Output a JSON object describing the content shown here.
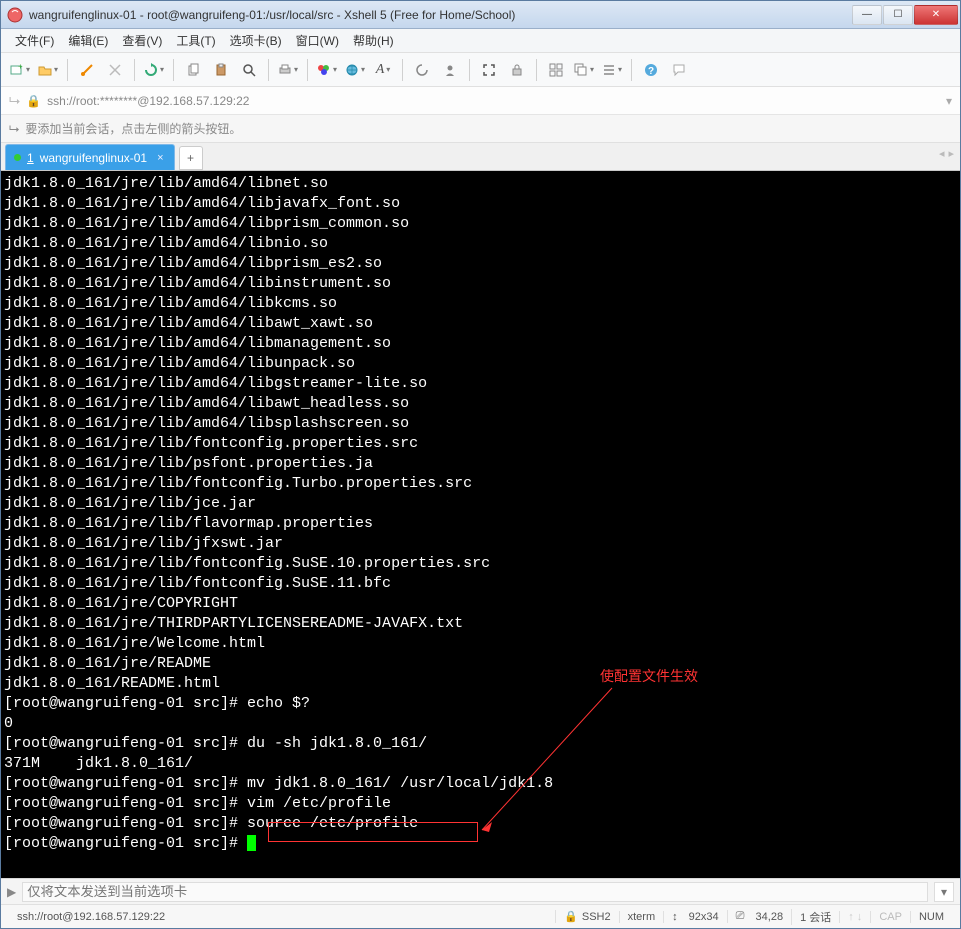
{
  "window": {
    "title": "wangruifenglinux-01 - root@wangruifeng-01:/usr/local/src - Xshell 5 (Free for Home/School)"
  },
  "menu": {
    "file": "文件(F)",
    "edit": "编辑(E)",
    "view": "查看(V)",
    "tools": "工具(T)",
    "tabs": "选项卡(B)",
    "window": "窗口(W)",
    "help": "帮助(H)"
  },
  "addressbar": {
    "lock_icon": "🔒",
    "url": "ssh://root:********@192.168.57.129:22"
  },
  "hintbar": {
    "icon": "➦",
    "text": "要添加当前会话，点击左侧的箭头按钮。"
  },
  "tabs": {
    "active": {
      "index": "1",
      "label": "wangruifenglinux-01"
    }
  },
  "terminal_lines": [
    "jdk1.8.0_161/jre/lib/amd64/libnet.so",
    "jdk1.8.0_161/jre/lib/amd64/libjavafx_font.so",
    "jdk1.8.0_161/jre/lib/amd64/libprism_common.so",
    "jdk1.8.0_161/jre/lib/amd64/libnio.so",
    "jdk1.8.0_161/jre/lib/amd64/libprism_es2.so",
    "jdk1.8.0_161/jre/lib/amd64/libinstrument.so",
    "jdk1.8.0_161/jre/lib/amd64/libkcms.so",
    "jdk1.8.0_161/jre/lib/amd64/libawt_xawt.so",
    "jdk1.8.0_161/jre/lib/amd64/libmanagement.so",
    "jdk1.8.0_161/jre/lib/amd64/libunpack.so",
    "jdk1.8.0_161/jre/lib/amd64/libgstreamer-lite.so",
    "jdk1.8.0_161/jre/lib/amd64/libawt_headless.so",
    "jdk1.8.0_161/jre/lib/amd64/libsplashscreen.so",
    "jdk1.8.0_161/jre/lib/fontconfig.properties.src",
    "jdk1.8.0_161/jre/lib/psfont.properties.ja",
    "jdk1.8.0_161/jre/lib/fontconfig.Turbo.properties.src",
    "jdk1.8.0_161/jre/lib/jce.jar",
    "jdk1.8.0_161/jre/lib/flavormap.properties",
    "jdk1.8.0_161/jre/lib/jfxswt.jar",
    "jdk1.8.0_161/jre/lib/fontconfig.SuSE.10.properties.src",
    "jdk1.8.0_161/jre/lib/fontconfig.SuSE.11.bfc",
    "jdk1.8.0_161/jre/COPYRIGHT",
    "jdk1.8.0_161/jre/THIRDPARTYLICENSEREADME-JAVAFX.txt",
    "jdk1.8.0_161/jre/Welcome.html",
    "jdk1.8.0_161/jre/README",
    "jdk1.8.0_161/README.html",
    "[root@wangruifeng-01 src]# echo $?",
    "0",
    "[root@wangruifeng-01 src]# du -sh jdk1.8.0_161/",
    "371M    jdk1.8.0_161/",
    "[root@wangruifeng-01 src]# mv jdk1.8.0_161/ /usr/local/jdk1.8",
    "[root@wangruifeng-01 src]# vim /etc/profile",
    "[root@wangruifeng-01 src]# source /etc/profile"
  ],
  "prompt_line": "[root@wangruifeng-01 src]# ",
  "annotation": {
    "text": "使配置文件生效"
  },
  "sendbar": {
    "placeholder": "仅将文本发送到当前选项卡"
  },
  "statusbar": {
    "conn": "ssh://root@192.168.57.129:22",
    "proto": "SSH2",
    "term": "xterm",
    "size": "92x34",
    "cursor": "34,28",
    "sessions": "1 会话",
    "cap": "CAP",
    "num": "NUM"
  }
}
